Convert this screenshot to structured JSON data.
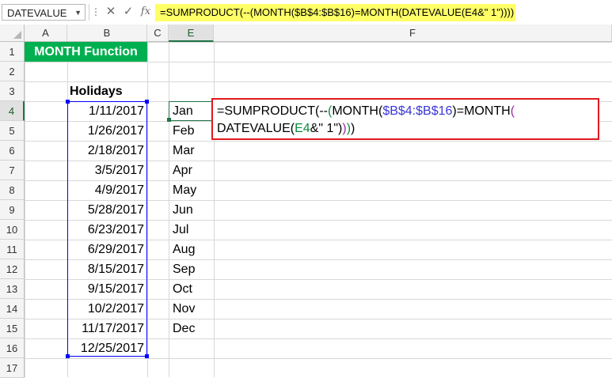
{
  "formula_bar": {
    "name_box": "DATEVALUE",
    "fx_label": "fx",
    "formula": "=SUMPRODUCT(--(MONTH($B$4:$B$16)=MONTH(DATEVALUE(E4&\" 1\"))))"
  },
  "columns": [
    "A",
    "B",
    "C",
    "E",
    "F"
  ],
  "rows": [
    "1",
    "2",
    "3",
    "4",
    "5",
    "6",
    "7",
    "8",
    "9",
    "10",
    "11",
    "12",
    "13",
    "14",
    "15",
    "16",
    "17"
  ],
  "sheet": {
    "title": "MONTH Function",
    "holidays_header": "Holidays",
    "holidays": [
      "1/11/2017",
      "1/26/2017",
      "2/18/2017",
      "3/5/2017",
      "4/9/2017",
      "5/28/2017",
      "6/23/2017",
      "6/29/2017",
      "8/15/2017",
      "9/15/2017",
      "10/2/2017",
      "11/17/2017",
      "12/25/2017"
    ],
    "months": [
      "Jan",
      "Feb",
      "Mar",
      "Apr",
      "May",
      "Jun",
      "Jul",
      "Aug",
      "Sep",
      "Oct",
      "Nov",
      "Dec"
    ]
  },
  "edit_cell": {
    "line1": {
      "p1": "=SUMPRODUCT(--",
      "p2": "(",
      "p3": "MONTH(",
      "p4": "$B$4:$B$16",
      "p5": ")=MONTH",
      "p6": "("
    },
    "line2": {
      "p1": "DATEVALUE(",
      "p2": "E4",
      "p3": "&\" 1\")",
      "p4": ")",
      "p5": ")",
      "p6": ")"
    }
  },
  "colors": {
    "title_fill": "#00b050",
    "range_outline": "#0000ff",
    "edit_outline": "#e0191e",
    "formula_highlight": "#ffff66"
  }
}
